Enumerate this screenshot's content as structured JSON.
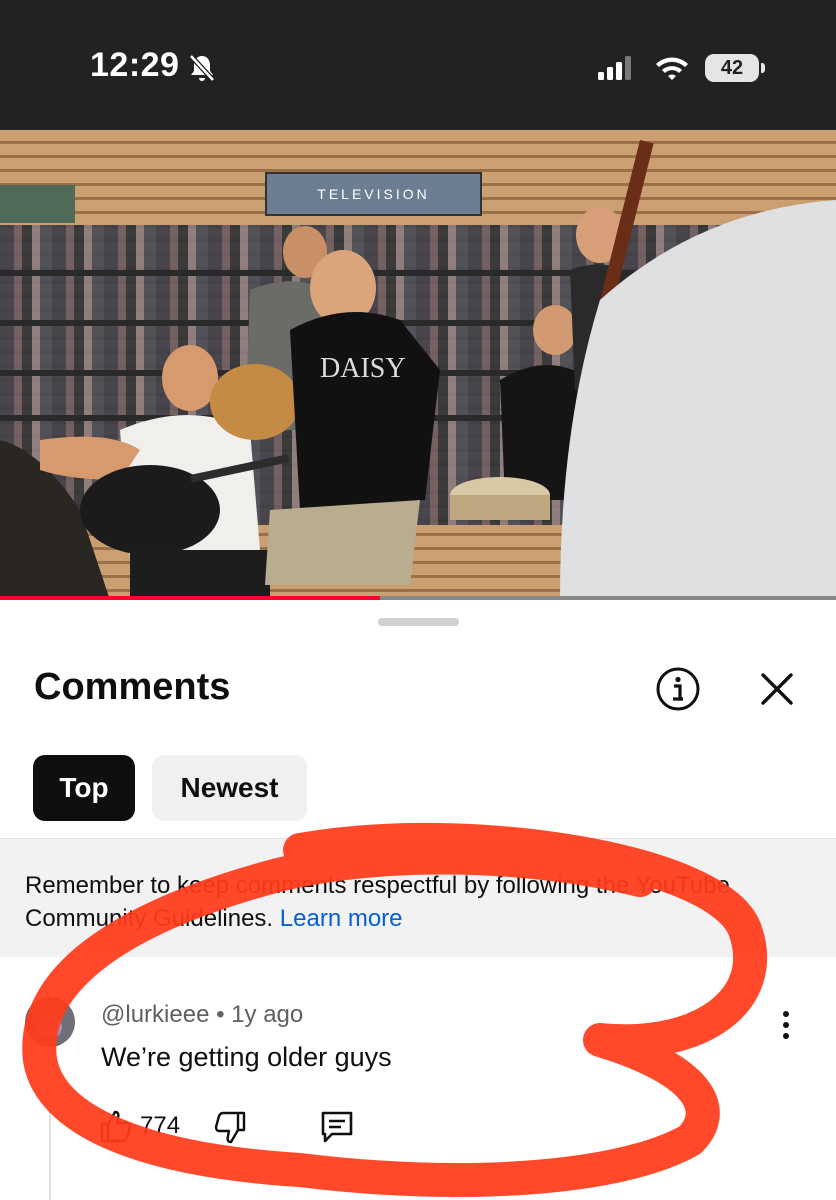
{
  "status_bar": {
    "time": "12:29",
    "battery": "42",
    "icons": [
      "bell-slash-icon",
      "signal-icon",
      "wifi-icon",
      "battery-icon"
    ]
  },
  "video": {
    "progress": 0.455,
    "banner_text": "TELEVISION",
    "shirt_text": "DAISY"
  },
  "comments": {
    "title": "Comments",
    "tabs": [
      {
        "label": "Top",
        "selected": true
      },
      {
        "label": "Newest",
        "selected": false
      }
    ],
    "notice": {
      "text": "Remember to keep comments respectful by following the YouTube Community Guidelines.",
      "link": "Learn more"
    },
    "items": [
      {
        "author": "@lurkieee",
        "age": "1y ago",
        "text": "We’re getting older guys",
        "likes": "774"
      }
    ]
  },
  "colors": {
    "accent_red": "#ff0033",
    "link_blue": "#065fd4",
    "annotation_red": "#ff3b1a"
  }
}
